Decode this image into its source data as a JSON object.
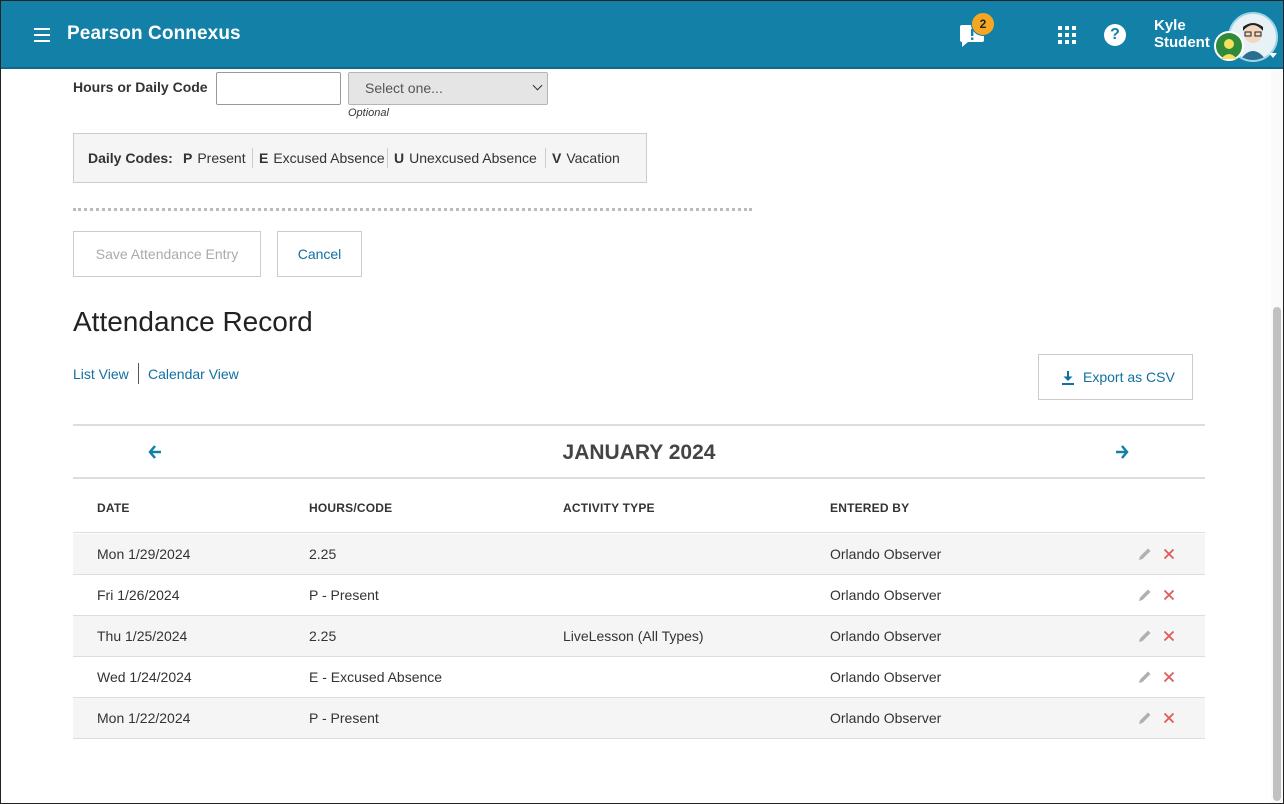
{
  "header": {
    "app_title": "Pearson Connexus",
    "notification_count": "2",
    "help_glyph": "?",
    "user_first": "Kyle",
    "user_last": "Student"
  },
  "form": {
    "hours_label": "Hours or Daily Code",
    "hours_value": "",
    "code_select_value": "Select one...",
    "optional_label": "Optional",
    "daily_codes_label": "Daily Codes:",
    "daily_codes": [
      {
        "code": "P",
        "label": "Present"
      },
      {
        "code": "E",
        "label": "Excused Absence"
      },
      {
        "code": "U",
        "label": "Unexcused Absence"
      },
      {
        "code": "V",
        "label": "Vacation"
      }
    ],
    "save_label": "Save Attendance Entry",
    "cancel_label": "Cancel"
  },
  "record": {
    "title": "Attendance Record",
    "list_view_label": "List View",
    "calendar_view_label": "Calendar View",
    "export_label": "Export as CSV",
    "month": "JANUARY 2024",
    "columns": [
      "DATE",
      "HOURS/CODE",
      "ACTIVITY TYPE",
      "ENTERED BY"
    ],
    "rows": [
      {
        "date": "Mon 1/29/2024",
        "hours": "2.25",
        "activity": "",
        "entered_by": "Orlando Observer"
      },
      {
        "date": "Fri 1/26/2024",
        "hours": "P - Present",
        "activity": "",
        "entered_by": "Orlando Observer"
      },
      {
        "date": "Thu 1/25/2024",
        "hours": "2.25",
        "activity": "LiveLesson (All Types)",
        "entered_by": "Orlando Observer"
      },
      {
        "date": "Wed 1/24/2024",
        "hours": "E - Excused Absence",
        "activity": "",
        "entered_by": "Orlando Observer"
      },
      {
        "date": "Mon 1/22/2024",
        "hours": "P - Present",
        "activity": "",
        "entered_by": "Orlando Observer"
      }
    ]
  },
  "icons": {
    "menu": "menu-icon",
    "notifications": "notification-icon",
    "apps": "apps-grid-icon",
    "help": "help-icon",
    "download": "download-icon",
    "prev": "arrow-left-icon",
    "next": "arrow-right-icon",
    "edit": "pencil-icon",
    "delete": "close-icon"
  },
  "colors": {
    "brand": "#1380a8",
    "link": "#1170a3",
    "badge": "#f5a623",
    "delete": "#e05a5a"
  }
}
